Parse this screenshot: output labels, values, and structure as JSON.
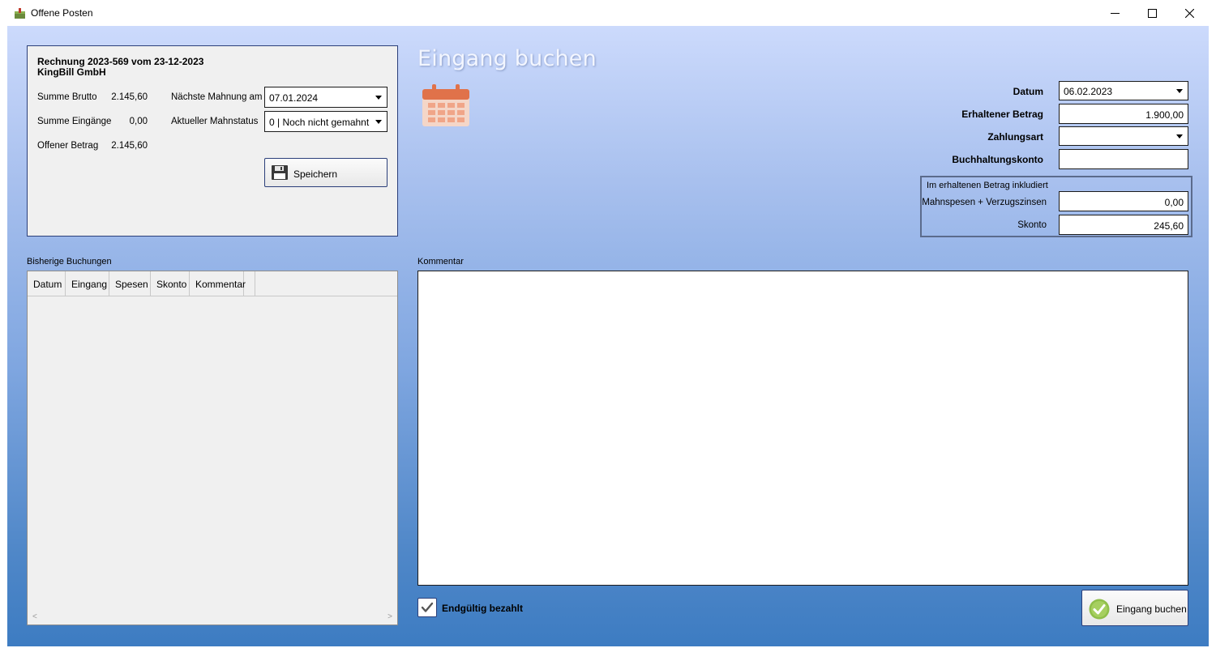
{
  "window": {
    "title": "Offene Posten"
  },
  "invoice": {
    "title_line1": "Rechnung 2023-569 vom 23-12-2023",
    "title_line2": "KingBill GmbH",
    "summe_brutto_label": "Summe Brutto",
    "summe_brutto_value": "2.145,60",
    "summe_eingaenge_label": "Summe Eingänge",
    "summe_eingaenge_value": "0,00",
    "offener_betrag_label": "Offener Betrag",
    "offener_betrag_value": "2.145,60",
    "naechste_mahnung_label": "Nächste Mahnung am",
    "naechste_mahnung_value": "07.01.2024",
    "mahnstatus_label": "Aktueller Mahnstatus",
    "mahnstatus_value": "0 | Noch nicht gemahnt",
    "save_label": "Speichern"
  },
  "booking": {
    "heading": "Eingang buchen",
    "datum_label": "Datum",
    "datum_value": "06.02.2023",
    "erhaltener_betrag_label": "Erhaltener Betrag",
    "erhaltener_betrag_value": "1.900,00",
    "zahlungsart_label": "Zahlungsart",
    "zahlungsart_value": "",
    "buchhaltungskonto_label": "Buchhaltungskonto",
    "buchhaltungskonto_value": "",
    "included_title": "Im erhaltenen Betrag inkludiert",
    "mahnspesen_label": "Mahnspesen + Verzugszinsen",
    "mahnspesen_value": "0,00",
    "skonto_label": "Skonto",
    "skonto_value": "245,60"
  },
  "history": {
    "section_label": "Bisherige Buchungen",
    "columns": [
      "Datum",
      "Eingang",
      "Spesen",
      "Skonto",
      "Kommentar",
      ""
    ],
    "rows": []
  },
  "comment": {
    "section_label": "Kommentar",
    "value": ""
  },
  "footer": {
    "paid_label": "Endgültig bezahlt",
    "paid_checked": true,
    "book_label": "Eingang buchen"
  }
}
